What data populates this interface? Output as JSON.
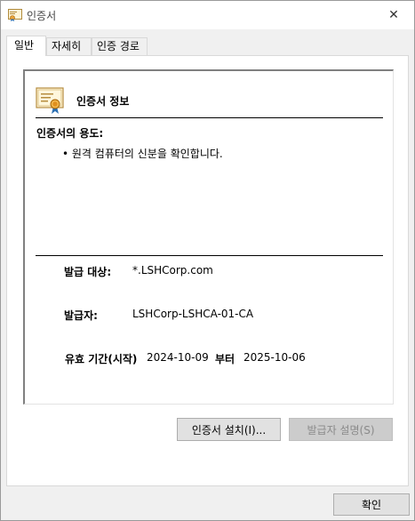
{
  "window": {
    "title": "인증서",
    "close_glyph": "✕"
  },
  "tabs": [
    {
      "label": "일반"
    },
    {
      "label": "자세히"
    },
    {
      "label": "인증 경로"
    }
  ],
  "info": {
    "title": "인증서 정보",
    "purpose_label": "인증서의 용도:",
    "purpose_items": [
      "• 원격 컴퓨터의 신분을 확인합니다."
    ]
  },
  "fields": {
    "issued_to_label": "발급 대상:",
    "issued_to_value": "*.LSHCorp.com",
    "issuer_label": "발급자:",
    "issuer_value": "LSHCorp-LSHCA-01-CA",
    "validity_label": "유효 기간(시작)",
    "valid_from": "2024-10-09",
    "to_label": "부터",
    "valid_to": "2025-10-06"
  },
  "buttons": {
    "install": "인증서 설치(I)...",
    "issuer_statement": "발급자 설명(S)",
    "ok": "확인"
  },
  "colors": {
    "cert_ribbon": "#2b6fb3",
    "cert_seal": "#e8a33a"
  }
}
